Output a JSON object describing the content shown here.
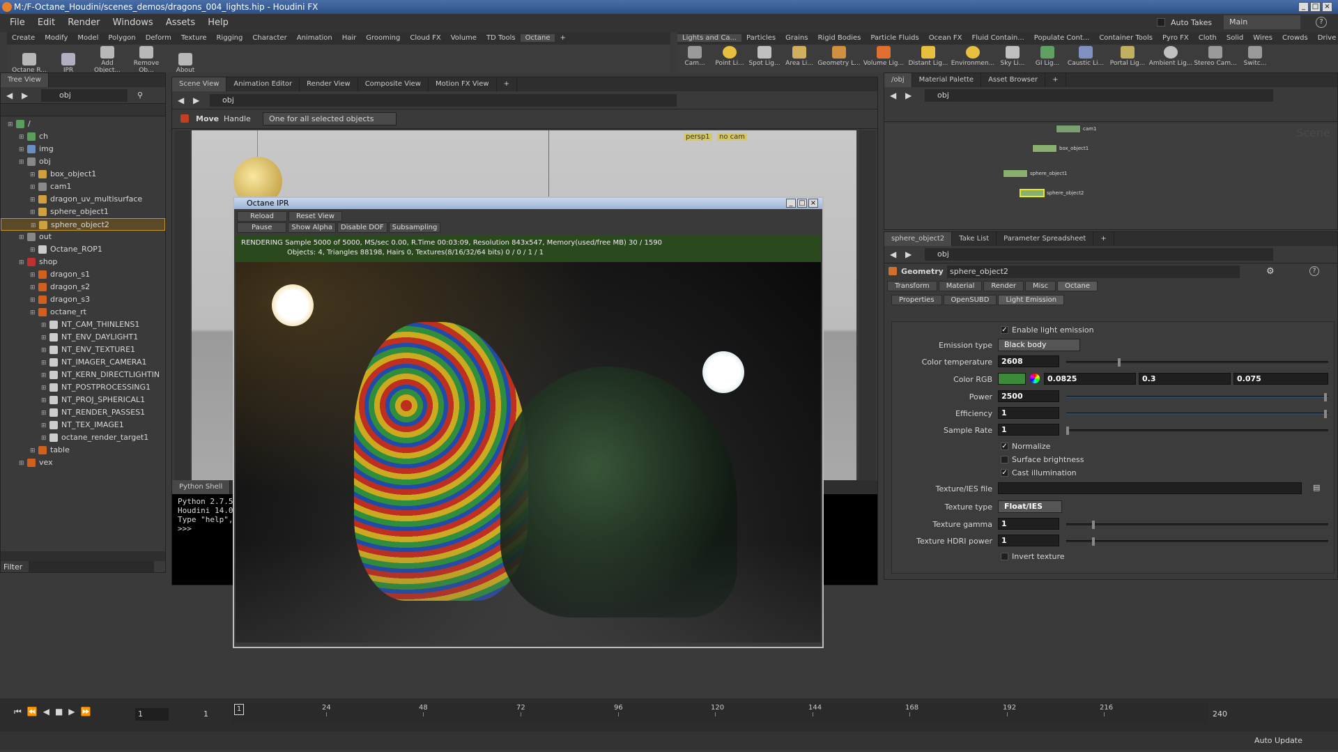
{
  "window": {
    "title": "M:/F-Octane_Houdini/scenes_demos/dragons_004_lights.hip - Houdini FX"
  },
  "menu": [
    "File",
    "Edit",
    "Render",
    "Windows",
    "Assets",
    "Help"
  ],
  "top_right": {
    "auto_takes": "Auto Takes",
    "desktop": "Main"
  },
  "shelf_tabs_left": [
    "Create",
    "Modify",
    "Model",
    "Polygon",
    "Deform",
    "Texture",
    "Rigging",
    "Character",
    "Animation",
    "Hair",
    "Grooming",
    "Cloud FX",
    "Volume",
    "TD Tools",
    "Octane"
  ],
  "shelf_tools_left": [
    "Octane R...",
    "IPR",
    "Add Object...",
    "Remove Ob...",
    "About"
  ],
  "shelf_tabs_right": [
    "Lights and Ca...",
    "Particles",
    "Grains",
    "Rigid Bodies",
    "Particle Fluids",
    "Ocean FX",
    "Fluid Contain...",
    "Populate Cont...",
    "Container Tools",
    "Pyro FX",
    "Cloth",
    "Solid",
    "Wires",
    "Crowds",
    "Drive Simulati..."
  ],
  "shelf_tools_right": [
    "Cam...",
    "Point Li...",
    "Spot Lig...",
    "Area Li...",
    "Geometry L...",
    "Volume Lig...",
    "Distant Lig...",
    "Environmen...",
    "Sky Li...",
    "GI Lig...",
    "Caustic Li...",
    "Portal Lig...",
    "Ambient Lig...",
    "Stereo Cam...",
    "Switc..."
  ],
  "tree": {
    "tab": "Tree View",
    "path": "obj",
    "filter_label": "Filter",
    "items": [
      {
        "label": "/",
        "depth": 0,
        "color": "#5aa05a"
      },
      {
        "label": "ch",
        "depth": 1,
        "color": "#5aa05a"
      },
      {
        "label": "img",
        "depth": 1,
        "color": "#6a8fc0"
      },
      {
        "label": "obj",
        "depth": 1,
        "color": "#888888"
      },
      {
        "label": "box_object1",
        "depth": 2,
        "color": "#d0a040"
      },
      {
        "label": "cam1",
        "depth": 2,
        "color": "#8a8a8a"
      },
      {
        "label": "dragon_uv_multisurface",
        "depth": 2,
        "color": "#d0a040"
      },
      {
        "label": "sphere_object1",
        "depth": 2,
        "color": "#d0a040"
      },
      {
        "label": "sphere_object2",
        "depth": 2,
        "color": "#d0a040",
        "selected": true
      },
      {
        "label": "out",
        "depth": 1,
        "color": "#888888"
      },
      {
        "label": "Octane_ROP1",
        "depth": 2,
        "color": "#cccccc"
      },
      {
        "label": "shop",
        "depth": 1,
        "color": "#c03030"
      },
      {
        "label": "dragon_s1",
        "depth": 2,
        "color": "#d06020"
      },
      {
        "label": "dragon_s2",
        "depth": 2,
        "color": "#d06020"
      },
      {
        "label": "dragon_s3",
        "depth": 2,
        "color": "#d06020"
      },
      {
        "label": "octane_rt",
        "depth": 2,
        "color": "#d06020"
      },
      {
        "label": "NT_CAM_THINLENS1",
        "depth": 3,
        "color": "#cccccc"
      },
      {
        "label": "NT_ENV_DAYLIGHT1",
        "depth": 3,
        "color": "#cccccc"
      },
      {
        "label": "NT_ENV_TEXTURE1",
        "depth": 3,
        "color": "#cccccc"
      },
      {
        "label": "NT_IMAGER_CAMERA1",
        "depth": 3,
        "color": "#cccccc"
      },
      {
        "label": "NT_KERN_DIRECTLIGHTIN",
        "depth": 3,
        "color": "#cccccc"
      },
      {
        "label": "NT_POSTPROCESSING1",
        "depth": 3,
        "color": "#cccccc"
      },
      {
        "label": "NT_PROJ_SPHERICAL1",
        "depth": 3,
        "color": "#cccccc"
      },
      {
        "label": "NT_RENDER_PASSES1",
        "depth": 3,
        "color": "#cccccc"
      },
      {
        "label": "NT_TEX_IMAGE1",
        "depth": 3,
        "color": "#cccccc"
      },
      {
        "label": "octane_render_target1",
        "depth": 3,
        "color": "#cccccc"
      },
      {
        "label": "table",
        "depth": 2,
        "color": "#d06020"
      },
      {
        "label": "vex",
        "depth": 1,
        "color": "#d06020"
      }
    ]
  },
  "viewer": {
    "tabs": [
      "Scene View",
      "Animation Editor",
      "Render View",
      "Composite View",
      "Motion FX View"
    ],
    "path": "obj",
    "tool": "Move",
    "handle": "Handle",
    "mode": "One for all selected objects",
    "cam_persp": "persp1",
    "cam_none": "no cam"
  },
  "ipr": {
    "title": "Octane IPR",
    "buttons_row1": [
      "Reload",
      "Reset View"
    ],
    "buttons_row2": [
      "Pause",
      "Show Alpha",
      "Disable DOF",
      "Subsampling"
    ],
    "status1": "RENDERING Sample 5000 of 5000,  MS/sec 0.00,  R.Time 00:03:09,  Resolution 843x547,  Memory(used/free MB) 30 / 1590",
    "status2": "Objects: 4,  Triangles 88198,  Hairs 0,  Textures(8/16/32/64 bits) 0 / 0 / 1 / 1"
  },
  "python": {
    "tab": "Python Shell",
    "line1": "Python 2.7.5",
    "line2": "Houdini 14.0",
    "line3": "Type \"help\",",
    "prompt": ">>>"
  },
  "network": {
    "tabs": [
      "/obj",
      "Material Palette",
      "Asset Browser"
    ],
    "path": "obj",
    "watermark": "Scene",
    "nodes": [
      "cam1",
      "box_object1",
      "sphere_object1",
      "sphere_object2"
    ]
  },
  "params": {
    "tabs": [
      "sphere_object2",
      "Take List",
      "Parameter Spreadsheet"
    ],
    "path": "obj",
    "type_label": "Geometry",
    "node_name": "sphere_object2",
    "main_tabs": [
      "Transform",
      "Material",
      "Render",
      "Misc",
      "Octane"
    ],
    "sub_tabs": [
      "Properties",
      "OpenSUBD",
      "Light Emission"
    ],
    "enable_light": "Enable light emission",
    "emission_type": {
      "label": "Emission type",
      "value": "Black body"
    },
    "color_temp": {
      "label": "Color temperature",
      "value": "2608",
      "level": 0.2
    },
    "color_rgb": {
      "label": "Color RGB",
      "r": "0.0825",
      "g": "0.3",
      "b": "0.075",
      "swatch": "#3d8a3a"
    },
    "power": {
      "label": "Power",
      "value": "2500",
      "level": 1.0
    },
    "efficiency": {
      "label": "Efficiency",
      "value": "1",
      "level": 1.0
    },
    "sample_rate": {
      "label": "Sample Rate",
      "value": "1",
      "level": 0.0
    },
    "normalize": "Normalize",
    "surface_brightness": "Surface brightness",
    "cast_illumination": "Cast illumination",
    "texture_ies": {
      "label": "Texture/IES file",
      "value": ""
    },
    "texture_type": {
      "label": "Texture type",
      "value": "Float/IES"
    },
    "texture_gamma": {
      "label": "Texture gamma",
      "value": "1",
      "level": 0.1
    },
    "texture_hdri": {
      "label": "Texture HDRI power",
      "value": "1",
      "level": 0.1
    },
    "invert_texture": "Invert texture"
  },
  "timeline": {
    "frame": "1",
    "start": "1",
    "start2": "1",
    "end": "240",
    "ticks": [
      "24",
      "48",
      "72",
      "96",
      "120",
      "144",
      "168",
      "192",
      "216"
    ],
    "auto_update": "Auto Update"
  }
}
